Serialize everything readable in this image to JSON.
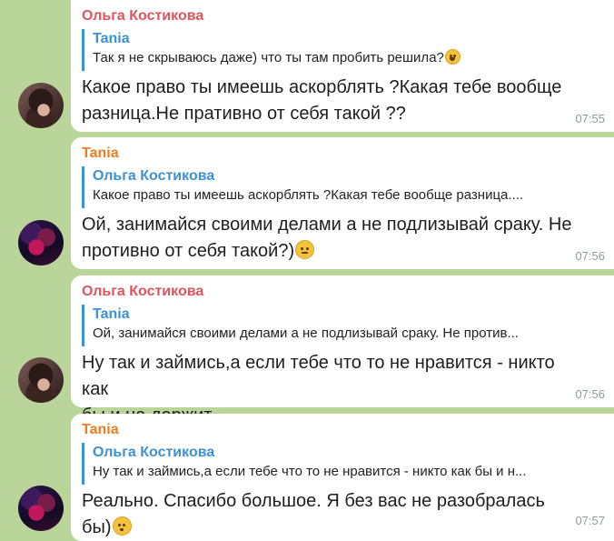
{
  "messages": [
    {
      "sender": "Ольга Костикова",
      "sender_color": "#e0555d",
      "reply_to": {
        "name": "Tania",
        "text": "Так я не скрываюсь даже) что ты там пробить решила?",
        "emoji": "face-with-tears-of-joy-icon"
      },
      "text_line1": "Какое право ты имеешь аскорблять ?Какая тебе вообще",
      "text_line2": "разница.Не пративно от себя такой ??",
      "time": "07:55",
      "avatar": "olga-avatar"
    },
    {
      "sender": "Tania",
      "sender_color": "#ec7d22",
      "reply_to": {
        "name": "Ольга Костикова",
        "text": "Какое право ты имеешь аскорблять ?Какая тебе вообще разница...."
      },
      "text_line1": "Ой, занимайся своими делами а не подлизывай сраку. Не",
      "text_line2": "противно от себя такой?)",
      "emoji": "grimacing-face-icon",
      "time": "07:56",
      "avatar": "tania-avatar"
    },
    {
      "sender": "Ольга Костикова",
      "sender_color": "#e0555d",
      "reply_to": {
        "name": "Tania",
        "text": "Ой, занимайся своими делами а не подлизывай сраку. Не против..."
      },
      "text_line1": "Ну так и займись,а если тебе что то не нравится - никто как",
      "text_line2": "бы и не держит",
      "time": "07:56",
      "avatar": "olga-avatar"
    },
    {
      "sender": "Tania",
      "sender_color": "#ec7d22",
      "reply_to": {
        "name": "Ольга Костикова",
        "text": "Ну так и займись,а если тебе что то не нравится - никто как бы и н..."
      },
      "text_line1": "Реально. Спасибо большое. Я без вас не разобралась бы)",
      "emoji": "face-blowing-kiss-icon",
      "time": "07:57",
      "avatar": "tania-avatar"
    }
  ]
}
